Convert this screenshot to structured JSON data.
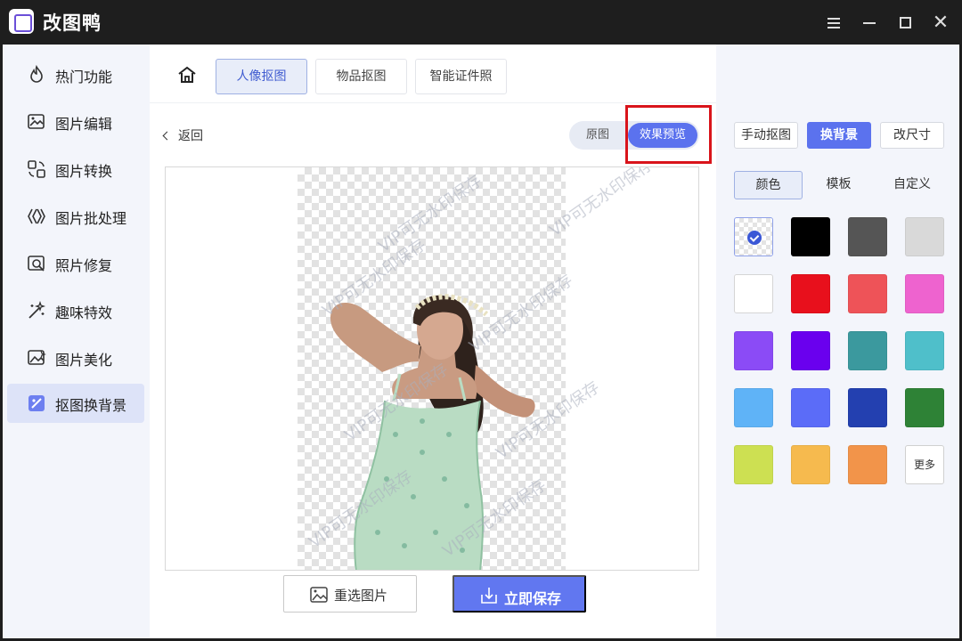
{
  "window": {
    "title": "改图鸭"
  },
  "sidebar": {
    "items": [
      {
        "label": "热门功能",
        "icon": "fire-icon"
      },
      {
        "label": "图片编辑",
        "icon": "image-edit-icon"
      },
      {
        "label": "图片转换",
        "icon": "convert-icon"
      },
      {
        "label": "图片批处理",
        "icon": "batch-icon"
      },
      {
        "label": "照片修复",
        "icon": "photo-repair-icon"
      },
      {
        "label": "趣味特效",
        "icon": "magic-wand-icon"
      },
      {
        "label": "图片美化",
        "icon": "beautify-icon"
      },
      {
        "label": "抠图换背景",
        "icon": "cutout-icon"
      }
    ],
    "active_index": 7
  },
  "topbar": {
    "tabs": [
      {
        "label": "人像抠图"
      },
      {
        "label": "物品抠图"
      },
      {
        "label": "智能证件照"
      }
    ],
    "active_index": 0
  },
  "main": {
    "back_label": "返回",
    "toggle": {
      "original_label": "原图",
      "preview_label": "效果预览"
    },
    "watermark_text": "VIP可无水印保存",
    "reselect_label": "重选图片",
    "save_label": "立即保存"
  },
  "right_panel": {
    "tabs": [
      {
        "label": "手动抠图"
      },
      {
        "label": "换背景"
      },
      {
        "label": "改尺寸"
      }
    ],
    "active_tab_index": 1,
    "subtabs": [
      {
        "label": "颜色"
      },
      {
        "label": "模板"
      },
      {
        "label": "自定义"
      }
    ],
    "active_subtab_index": 0,
    "colors": [
      "transparent",
      "#000000",
      "#555555",
      "#d9d9d9",
      "#ffffff",
      "#e8101c",
      "#ee5358",
      "#ee63cf",
      "#8b4bf6",
      "#6a00ee",
      "#3b999e",
      "#4fbfca",
      "#5fb3f7",
      "#5b6cf8",
      "#2340b0",
      "#2e8236",
      "#cde052",
      "#f6ba4e",
      "#f2944a"
    ],
    "selected_color_index": 0,
    "more_label": "更多"
  }
}
